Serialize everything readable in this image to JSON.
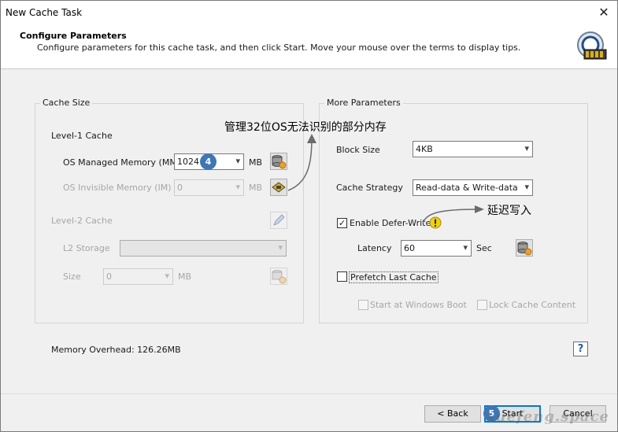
{
  "window": {
    "title": "New Cache Task",
    "close_glyph": "✕"
  },
  "header": {
    "title": "Configure Parameters",
    "subtitle": "Configure parameters for this cache task, and then click Start. Move your mouse over the terms to display tips.",
    "icon": "cache-chip-icon"
  },
  "cache_size": {
    "label": "Cache Size",
    "level1_label": "Level-1 Cache",
    "os_managed_label": "OS Managed Memory (MM)",
    "os_managed_value": "1024",
    "os_managed_unit": "MB",
    "os_invisible_label": "OS Invisible Memory (IM)",
    "os_invisible_value": "0",
    "os_invisible_unit": "MB",
    "level2_label": "Level-2 Cache",
    "l2_storage_label": "L2 Storage",
    "l2_storage_value": "",
    "size_label": "Size",
    "size_value": "0",
    "size_unit": "MB"
  },
  "more_params": {
    "label": "More Parameters",
    "block_size_label": "Block Size",
    "block_size_value": "4KB",
    "cache_strategy_label": "Cache Strategy",
    "cache_strategy_value": "Read-data & Write-data",
    "defer_write_label": "Enable Defer-Write",
    "defer_write_checked": true,
    "latency_label": "Latency",
    "latency_value": "60",
    "latency_unit": "Sec",
    "prefetch_label": "Prefetch Last Cache",
    "prefetch_checked": false,
    "start_boot_label": "Start at Windows Boot",
    "lock_cache_label": "Lock Cache Content"
  },
  "memory_overhead": "Memory Overhead: 126.26MB",
  "annotations": {
    "im_note": "管理32位OS无法识别的部分内存",
    "defer_note": "延迟写入",
    "badge4": "4",
    "badge5": "5"
  },
  "footer": {
    "back_label": "< Back",
    "start_label": "Start",
    "cancel_label": "Cancel",
    "help_glyph": "?"
  },
  "watermark": "xuefeng.space",
  "colors": {
    "accent": "#0078d7",
    "badge": "#3d77b8",
    "warning": "#f2d100"
  }
}
